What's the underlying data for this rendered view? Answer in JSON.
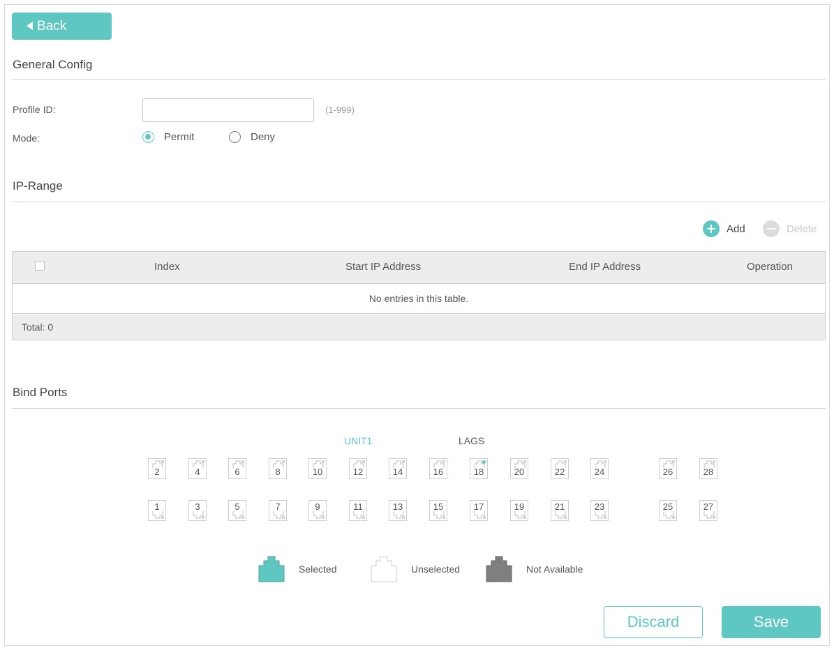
{
  "back_label": "Back",
  "general": {
    "title": "General Config",
    "profile_label": "Profile ID:",
    "profile_value": "",
    "profile_hint": "(1-999)",
    "mode_label": "Mode:",
    "mode_options": [
      "Permit",
      "Deny"
    ],
    "mode_selected": "Permit"
  },
  "ip_range": {
    "title": "IP-Range",
    "add_label": "Add",
    "delete_label": "Delete",
    "columns": [
      "Index",
      "Start IP Address",
      "End IP Address",
      "Operation"
    ],
    "empty_text": "No entries in this table.",
    "total_label": "Total: 0"
  },
  "bind_ports": {
    "title": "Bind Ports",
    "unit_label": "UNIT1",
    "lags_label": "LAGS",
    "top_row": [
      "2",
      "4",
      "6",
      "8",
      "10",
      "12",
      "14",
      "16",
      "18",
      "20",
      "22",
      "24",
      "26",
      "28"
    ],
    "bottom_row": [
      "1",
      "3",
      "5",
      "7",
      "9",
      "11",
      "13",
      "15",
      "17",
      "19",
      "21",
      "23",
      "25",
      "27"
    ],
    "active_port": "18",
    "legend": [
      "Selected",
      "Unselected",
      "Not Available"
    ]
  },
  "colors": {
    "accent": "#5ec7c1",
    "not_available": "#7f7f7f"
  },
  "buttons": {
    "discard": "Discard",
    "save": "Save"
  }
}
